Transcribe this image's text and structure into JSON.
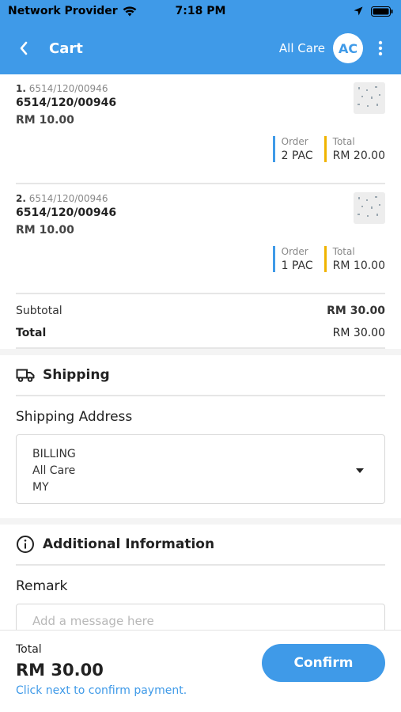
{
  "status_bar": {
    "carrier": "Network Provider",
    "time": "7:18 PM"
  },
  "header": {
    "title": "Cart",
    "account_name": "All Care",
    "avatar_initials": "AC"
  },
  "cart_items": [
    {
      "index": "1.",
      "code": "6514/120/00946",
      "name": "6514/120/00946",
      "price": "RM 10.00",
      "order_label": "Order",
      "order_value": "2 PAC",
      "total_label": "Total",
      "total_value": "RM 20.00"
    },
    {
      "index": "2.",
      "code": "6514/120/00946",
      "name": "6514/120/00946",
      "price": "RM 10.00",
      "order_label": "Order",
      "order_value": "1 PAC",
      "total_label": "Total",
      "total_value": "RM 10.00"
    }
  ],
  "summary": {
    "subtotal_label": "Subtotal",
    "subtotal_value": "RM 30.00",
    "total_label": "Total",
    "total_value": "RM 30.00"
  },
  "shipping": {
    "section_title": "Shipping",
    "address_label": "Shipping Address",
    "address_lines": [
      "BILLING",
      "All Care",
      "MY"
    ]
  },
  "additional": {
    "section_title": "Additional Information",
    "remark_label": "Remark",
    "remark_placeholder": "Add a message here"
  },
  "footer": {
    "total_label": "Total",
    "total_value": "RM 30.00",
    "hint": "Click next to confirm payment.",
    "confirm_label": "Confirm"
  },
  "colors": {
    "primary": "#3f9ae8",
    "accent_total": "#f0b400"
  }
}
